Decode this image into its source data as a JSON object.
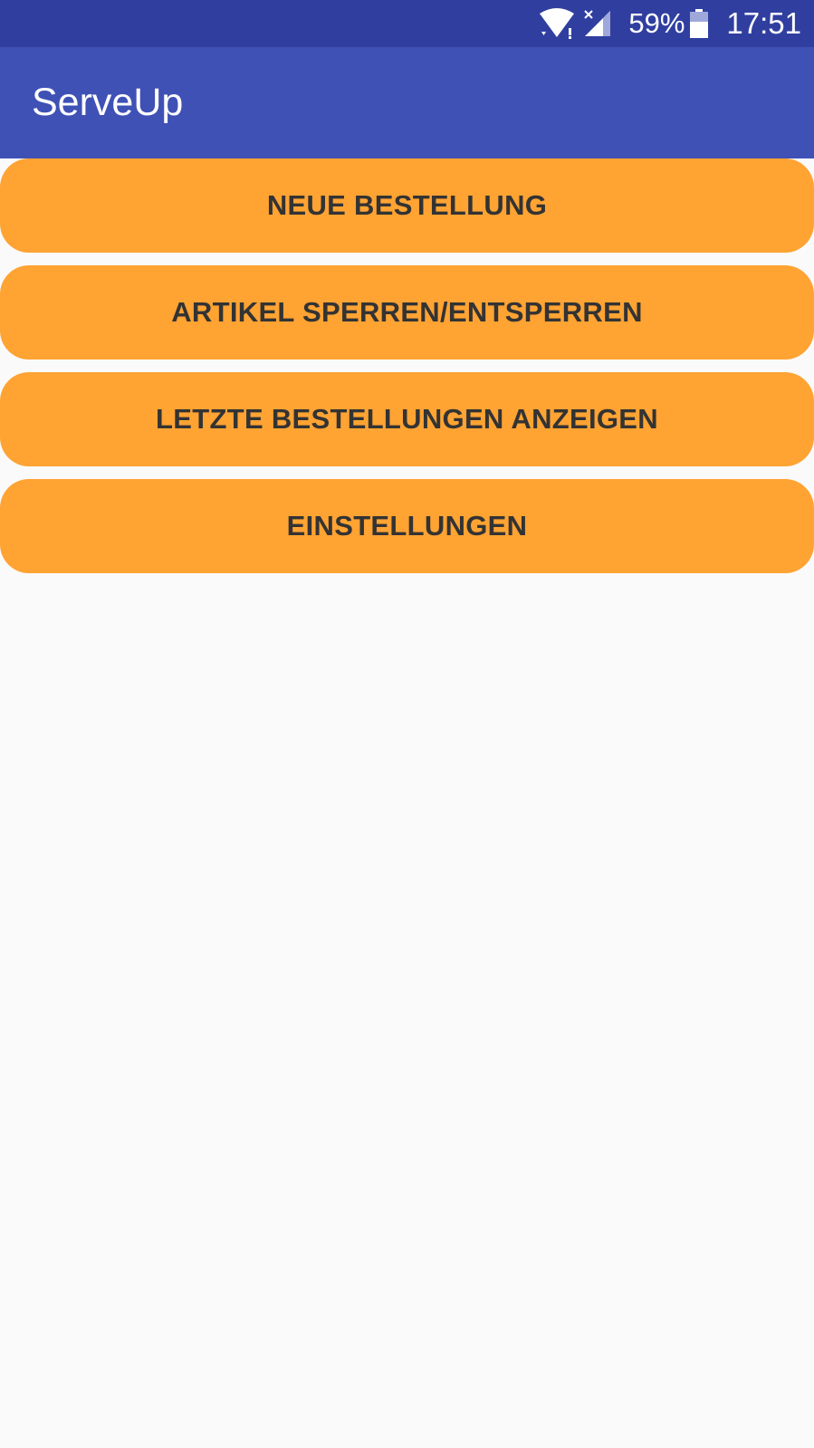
{
  "status_bar": {
    "battery_percent": "59%",
    "time": "17:51",
    "icons": [
      "wifi-icon",
      "signal-icon",
      "battery-icon"
    ],
    "color": "#303f9f"
  },
  "app_bar": {
    "title": "ServeUp",
    "color": "#3f51b5"
  },
  "menu": {
    "button_color": "#ffa333",
    "items": [
      {
        "label": "NEUE BESTELLUNG"
      },
      {
        "label": "ARTIKEL SPERREN/ENTSPERREN"
      },
      {
        "label": "LETZTE BESTELLUNGEN ANZEIGEN"
      },
      {
        "label": "EINSTELLUNGEN"
      }
    ]
  }
}
